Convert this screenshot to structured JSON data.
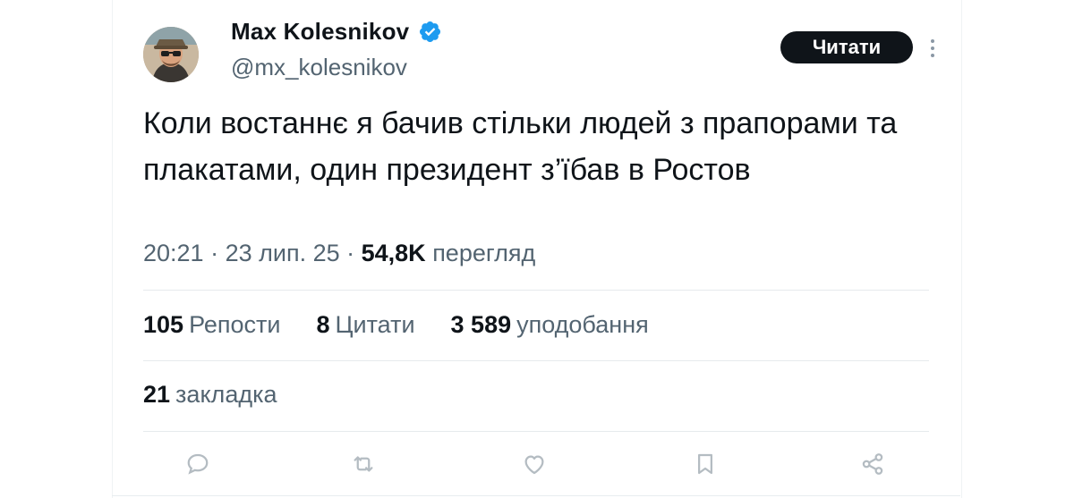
{
  "author": {
    "name": "Max Kolesnikov",
    "handle": "@mx_kolesnikov",
    "verified_icon": "verified-badge-icon",
    "avatar_icon": "user-avatar"
  },
  "follow_button": {
    "label": "Читати"
  },
  "more_icon": "more-vertical-icon",
  "tweet": {
    "text": "Коли востаннє я бачив стільки людей з прапорами та плакатами, один президент з’їбав в Ростов"
  },
  "meta": {
    "time": "20:21",
    "separator": " · ",
    "date": "23 лип. 25",
    "views_count": "54,8K",
    "views_label": "перегляд"
  },
  "stats": {
    "reposts": {
      "count": "105",
      "label": "Репости"
    },
    "quotes": {
      "count": "8",
      "label": "Цитати"
    },
    "likes": {
      "count": "3 589",
      "label": "уподобання"
    },
    "bookmarks": {
      "count": "21",
      "label": "закладка"
    }
  },
  "actions": [
    "reply-icon",
    "repost-icon",
    "like-icon",
    "bookmark-icon",
    "share-icon"
  ],
  "colors": {
    "text_primary": "#0f1419",
    "text_secondary": "#536471",
    "verified_blue": "#1d9bf0",
    "button_bg": "#0f1419",
    "icon_gray": "#b4bcc2",
    "divider": "#e6eaed"
  }
}
